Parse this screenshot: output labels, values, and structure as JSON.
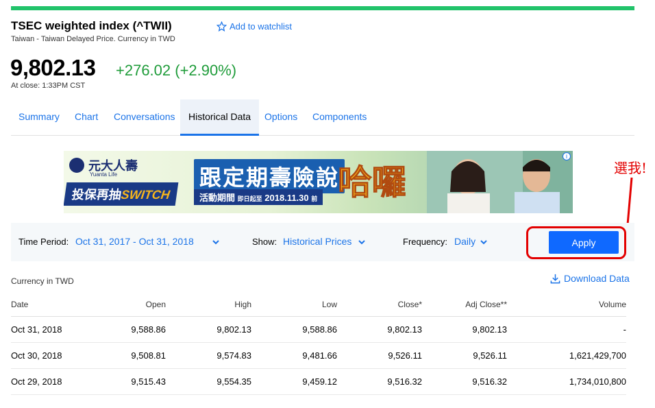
{
  "header": {
    "title": "TSEC weighted index (^TWII)",
    "subtitle": "Taiwan - Taiwan Delayed Price. Currency in TWD",
    "watchlist_label": "Add to watchlist"
  },
  "quote": {
    "price": "9,802.13",
    "change": "+276.02 (+2.90%)",
    "close_time": "At close: 1:33PM CST"
  },
  "tabs": [
    {
      "label": "Summary"
    },
    {
      "label": "Chart"
    },
    {
      "label": "Conversations"
    },
    {
      "label": "Historical Data",
      "active": true
    },
    {
      "label": "Options"
    },
    {
      "label": "Components"
    }
  ],
  "ad": {
    "brand": "元大人壽",
    "brand_small": "Yuanta Life",
    "tagline_prefix": "投保再抽",
    "tagline_highlight": "SWITCH",
    "headline": "跟定期壽險說",
    "hero": "哈囉",
    "subline_label": "活動期間",
    "subline_small": "即日起至",
    "subline_date": "2018.11.30",
    "subline_suffix": "前",
    "info_icon_label": "i"
  },
  "annotation": {
    "text": "選我!",
    "color": "#e30000"
  },
  "controls": {
    "time_period_label": "Time Period:",
    "time_period_value": "Oct 31, 2017 - Oct 31, 2018",
    "show_label": "Show:",
    "show_value": "Historical Prices",
    "frequency_label": "Frequency:",
    "frequency_value": "Daily",
    "apply_label": "Apply"
  },
  "table": {
    "currency_note": "Currency in TWD",
    "download_label": "Download Data",
    "columns": [
      "Date",
      "Open",
      "High",
      "Low",
      "Close*",
      "Adj Close**",
      "Volume"
    ],
    "rows": [
      [
        "Oct 31, 2018",
        "9,588.86",
        "9,802.13",
        "9,588.86",
        "9,802.13",
        "9,802.13",
        "-"
      ],
      [
        "Oct 30, 2018",
        "9,508.81",
        "9,574.83",
        "9,481.66",
        "9,526.11",
        "9,526.11",
        "1,621,429,700"
      ],
      [
        "Oct 29, 2018",
        "9,515.43",
        "9,554.35",
        "9,459.12",
        "9,516.32",
        "9,516.32",
        "1,734,010,800"
      ]
    ]
  },
  "colors": {
    "accent": "#1a73e8",
    "positive": "#1f9c3a",
    "top_bar": "#21c36a",
    "apply_button": "#0f69ff"
  }
}
